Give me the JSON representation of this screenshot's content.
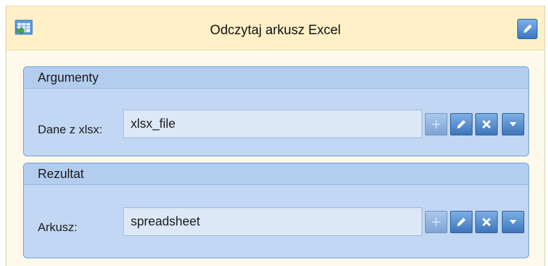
{
  "header": {
    "title": "Odczytaj arkusz Excel",
    "icon": "excel-sheet-icon",
    "edit_icon": "pencil-icon"
  },
  "arguments": {
    "title": "Argumenty",
    "label": "Dane z xlsx:",
    "value": "xlsx_file"
  },
  "result": {
    "title": "Rezultat",
    "label": "Arkusz:",
    "value": "spreadsheet"
  },
  "toolbar_icons": [
    "plus-icon",
    "pencil-icon",
    "close-icon",
    "dropdown-arrow-icon"
  ],
  "colors": {
    "header_bg": "#fff0c7",
    "section_bg": "#c2d7f3",
    "button_blue": "#3d76bb"
  }
}
